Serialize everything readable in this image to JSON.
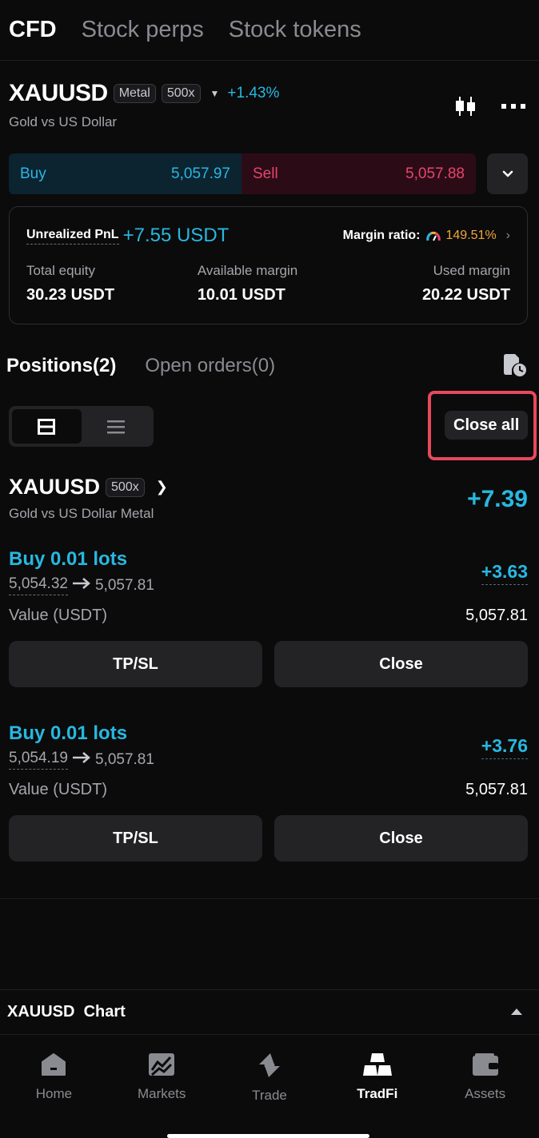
{
  "top_tabs": [
    "CFD",
    "Stock perps",
    "Stock tokens"
  ],
  "symbol": {
    "name": "XAUUSD",
    "category_chip": "Metal",
    "leverage_chip": "500x",
    "change_pct": "+1.43%",
    "description": "Gold vs US Dollar",
    "icons": [
      "candlestick-icon",
      "more-icon"
    ]
  },
  "quote": {
    "buy_label": "Buy",
    "buy_price": "5,057.97",
    "sell_label": "Sell",
    "sell_price": "5,057.88"
  },
  "account": {
    "upnl_label": "Unrealized PnL",
    "upnl_value": "+7.55 USDT",
    "margin_ratio_label": "Margin ratio:",
    "margin_ratio_value": "149.51%",
    "total_equity_label": "Total equity",
    "total_equity_value": "30.23 USDT",
    "available_margin_label": "Available margin",
    "available_margin_value": "10.01 USDT",
    "used_margin_label": "Used margin",
    "used_margin_value": "20.22 USDT"
  },
  "positions_tabs": {
    "positions": "Positions(2)",
    "open_orders": "Open orders(0)"
  },
  "close_all_label": "Close all",
  "group": {
    "name": "XAUUSD",
    "leverage": "500x",
    "subtitle": "Gold vs US Dollar  Metal",
    "pnl": "+7.39"
  },
  "positions": [
    {
      "title": "Buy 0.01 lots",
      "entry": "5,054.32",
      "current": "5,057.81",
      "pnl": "+3.63",
      "value_label": "Value (USDT)",
      "value": "5,057.81",
      "tpsl_label": "TP/SL",
      "close_label": "Close"
    },
    {
      "title": "Buy 0.01 lots",
      "entry": "5,054.19",
      "current": "5,057.81",
      "pnl": "+3.76",
      "value_label": "Value (USDT)",
      "value": "5,057.81",
      "tpsl_label": "TP/SL",
      "close_label": "Close"
    }
  ],
  "chart_bar_title": "XAUUSD  Chart",
  "bottom_nav": [
    {
      "label": "Home",
      "icon": "home-icon"
    },
    {
      "label": "Markets",
      "icon": "markets-icon"
    },
    {
      "label": "Trade",
      "icon": "trade-icon"
    },
    {
      "label": "TradFi",
      "icon": "tradfi-icon"
    },
    {
      "label": "Assets",
      "icon": "assets-icon"
    }
  ],
  "colors": {
    "accent_blue": "#27b8e0",
    "sell_red": "#e6456f",
    "margin_orange": "#f0a73a",
    "highlight_red": "#e8495c"
  }
}
